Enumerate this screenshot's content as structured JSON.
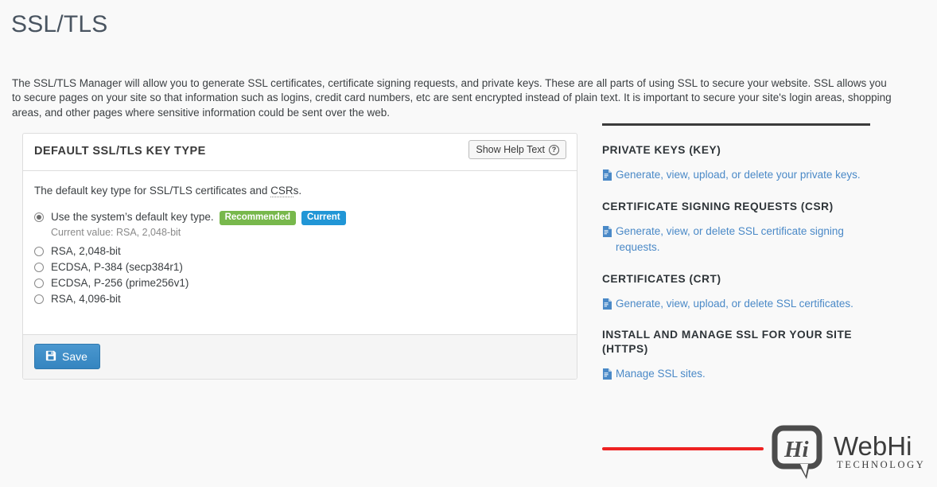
{
  "page": {
    "title": "SSL/TLS",
    "intro": "The SSL/TLS Manager will allow you to generate SSL certificates, certificate signing requests, and private keys. These are all parts of using SSL to secure your website. SSL allows you to secure pages on your site so that information such as logins, credit card numbers, etc are sent encrypted instead of plain text. It is important to secure your site's login areas, shopping areas, and other pages where sensitive information could be sent over the web.",
    "background_color": "#f9f9f9"
  },
  "panel": {
    "title": "DEFAULT SSL/TLS KEY TYPE",
    "help_button_label": "Show Help Text",
    "help_icon": "question-circle-icon",
    "description_before": "The default key type for SSL/TLS certificates and ",
    "description_abbr": "CSR",
    "description_after": "s.",
    "options": [
      {
        "label": "Use the system’s default key type.",
        "checked": true,
        "badges": [
          {
            "text": "Recommended",
            "color": "#78b84c"
          },
          {
            "text": "Current",
            "color": "#2196d6"
          }
        ],
        "sub_text": "Current value: RSA, 2,048-bit"
      },
      {
        "label": "RSA, 2,048-bit",
        "checked": false
      },
      {
        "label": "ECDSA, P-384 (secp384r1)",
        "checked": false
      },
      {
        "label": "ECDSA, P-256 (prime256v1)",
        "checked": false
      },
      {
        "label": "RSA, 4,096-bit",
        "checked": false
      }
    ],
    "save_label": "Save",
    "save_icon": "floppy-disk-icon",
    "save_color": "#337ab7"
  },
  "sidebar": {
    "sections": [
      {
        "heading": "PRIVATE KEYS (KEY)",
        "link": "Generate, view, upload, or delete your private keys.",
        "icon": "file-document-icon"
      },
      {
        "heading": "CERTIFICATE SIGNING REQUESTS (CSR)",
        "link": "Generate, view, or delete SSL certificate signing requests.",
        "icon": "file-document-icon"
      },
      {
        "heading": "CERTIFICATES (CRT)",
        "link": "Generate, view, upload, or delete SSL certificates.",
        "icon": "file-document-icon"
      },
      {
        "heading": "INSTALL AND MANAGE SSL FOR YOUR SITE (HTTPS)",
        "link": "Manage SSL sites.",
        "icon": "file-document-icon"
      }
    ],
    "link_color": "#4a89c7",
    "annotation_color": "#ee2222"
  },
  "logo": {
    "bubble_text": "Hi",
    "name": "WebHi",
    "tagline": "TECHNOLOGY"
  }
}
